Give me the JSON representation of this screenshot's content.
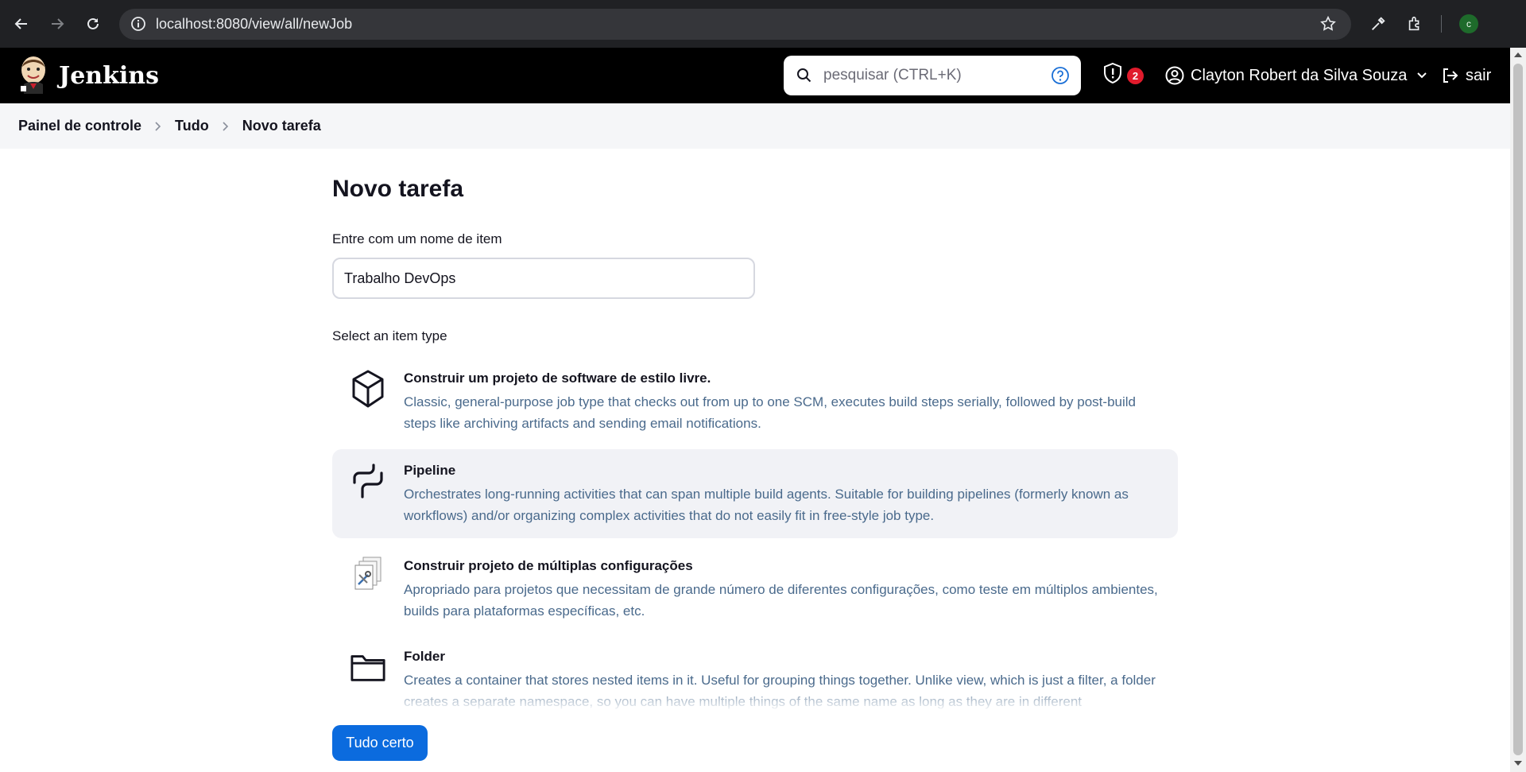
{
  "browser": {
    "url": "localhost:8080/view/all/newJob",
    "profile_initial": "c",
    "icons": [
      "back-arrow-icon",
      "forward-arrow-icon",
      "reload-icon",
      "site-info-icon",
      "bookmark-star-icon",
      "eyedropper-icon",
      "extensions-icon"
    ]
  },
  "header": {
    "brand": "Jenkins",
    "search": {
      "placeholder": "pesquisar (CTRL+K)"
    },
    "security_count": "2",
    "user_name": "Clayton Robert da Silva Souza",
    "logout_label": "sair"
  },
  "breadcrumbs": [
    "Painel de controle",
    "Tudo",
    "Novo tarefa"
  ],
  "main": {
    "title": "Novo tarefa",
    "name_label": "Entre com um nome de item",
    "name_value": "Trabalho DevOps",
    "type_label": "Select an item type",
    "items": [
      {
        "name": "Construir um projeto de software de estilo livre.",
        "description": "Classic, general-purpose job type that checks out from up to one SCM, executes build steps serially, followed by post-build steps like archiving artifacts and sending email notifications.",
        "icon": "package-icon",
        "selected": false
      },
      {
        "name": "Pipeline",
        "description": "Orchestrates long-running activities that can span multiple build agents. Suitable for building pipelines (formerly known as workflows) and/or organizing complex activities that do not easily fit in free-style job type.",
        "icon": "pipeline-icon",
        "selected": true
      },
      {
        "name": "Construir projeto de múltiplas configurações",
        "description": "Apropriado para projetos que necessitam de grande número de diferentes configurações, como teste em múltiplos ambientes, builds para plataformas específicas, etc.",
        "icon": "multi-config-icon",
        "selected": false
      },
      {
        "name": "Folder",
        "description": "Creates a container that stores nested items in it. Useful for grouping things together. Unlike view, which is just a filter, a folder creates a separate namespace, so you can have multiple things of the same name as long as they are in different",
        "icon": "folder-icon",
        "selected": false
      }
    ],
    "submit_label": "Tudo certo"
  },
  "colors": {
    "accent": "#0b6bde",
    "header_bg": "#000000",
    "description_text": "#4a6a8c",
    "badge": "#e01b2c"
  }
}
